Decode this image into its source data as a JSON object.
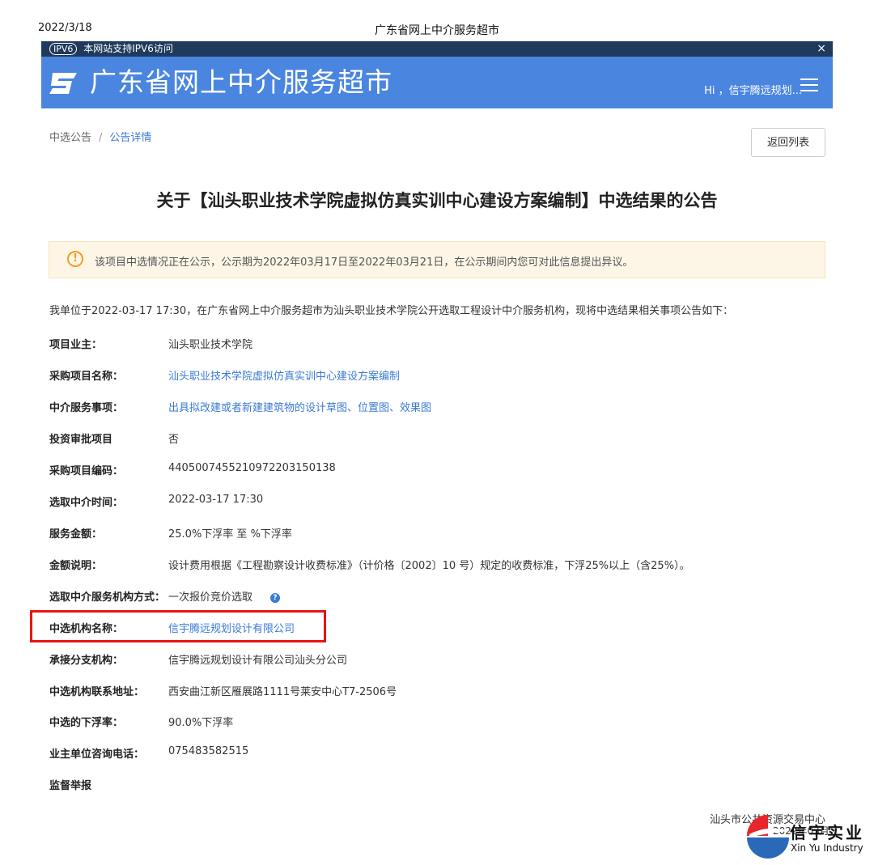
{
  "print_header": {
    "date": "2022/3/18",
    "title": "广东省网上中介服务超市"
  },
  "ipv6_bar": {
    "badge": "IPV6",
    "text": "本网站支持IPV6访问",
    "close": "×"
  },
  "header": {
    "site_name": "广东省网上中介服务超市",
    "greeting": "Hi ，信宇腾远规划..."
  },
  "breadcrumb": {
    "parent": "中选公告",
    "separator": "/",
    "current": "公告详情"
  },
  "back_button": "返回列表",
  "notice_title": "关于【汕头职业技术学院虚拟仿真实训中心建设方案编制】中选结果的公告",
  "alert": {
    "text": "该项目中选情况正在公示，公示期为2022年03月17日至2022年03月21日，在公示期间内您可对此信息提出异议。"
  },
  "intro": "我单位于2022-03-17 17:30，在广东省网上中介服务超市为汕头职业技术学院公开选取工程设计中介服务机构，现将中选结果相关事项公告如下：",
  "details": [
    {
      "label": "项目业主：",
      "value": "汕头职业技术学院"
    },
    {
      "label": "采购项目名称：",
      "value": "汕头职业技术学院虚拟仿真实训中心建设方案编制"
    },
    {
      "label": "中介服务事项：",
      "value": "出具拟改建或者新建建筑物的设计草图、位置图、效果图"
    },
    {
      "label": "投资审批项目",
      "value": "否"
    },
    {
      "label": "采购项目编码：",
      "value": "440500745521097220315013‍8"
    },
    {
      "label": "选取中介时间：",
      "value": "2022-03-17 17:30"
    },
    {
      "label": "服务金额：",
      "value": "25.0%下浮率 至 %下浮率"
    },
    {
      "label": "金额说明：",
      "value": "设计费用根据《工程勘察设计收费标准》（计价格〔2002〕10 号）规定的收费标准，下浮25%以上（含25%）。"
    },
    {
      "label": "选取中介服务机构方式：",
      "value": "一次报价竞价选取"
    },
    {
      "label": "中选机构名称：",
      "value": "信宇腾远规划设计有限公司"
    },
    {
      "label": "承接分支机构：",
      "value": "信宇腾远规划设计有限公司汕头分公司"
    },
    {
      "label": "中选机构联系地址：",
      "value": "西安曲江新区雁展路1111号莱安中心T7-2506号"
    },
    {
      "label": "中选的下浮率：",
      "value": "90.0%下浮率"
    },
    {
      "label": "业主单位咨询电话：",
      "value": "075483582515"
    },
    {
      "label": "监督举报",
      "value": ""
    }
  ],
  "footer": {
    "org": "汕头市公共资源交易中心",
    "date": "2022年03月"
  },
  "watermark": {
    "cn": "信宇实业",
    "en": "Xin Yu Industry"
  },
  "colors": {
    "header_bg": "#4a86e0",
    "ipv6_bg": "#1f3a5c",
    "link": "#3a7bd5",
    "highlight": "#e81414",
    "alert_bg": "#fdf6e7"
  }
}
